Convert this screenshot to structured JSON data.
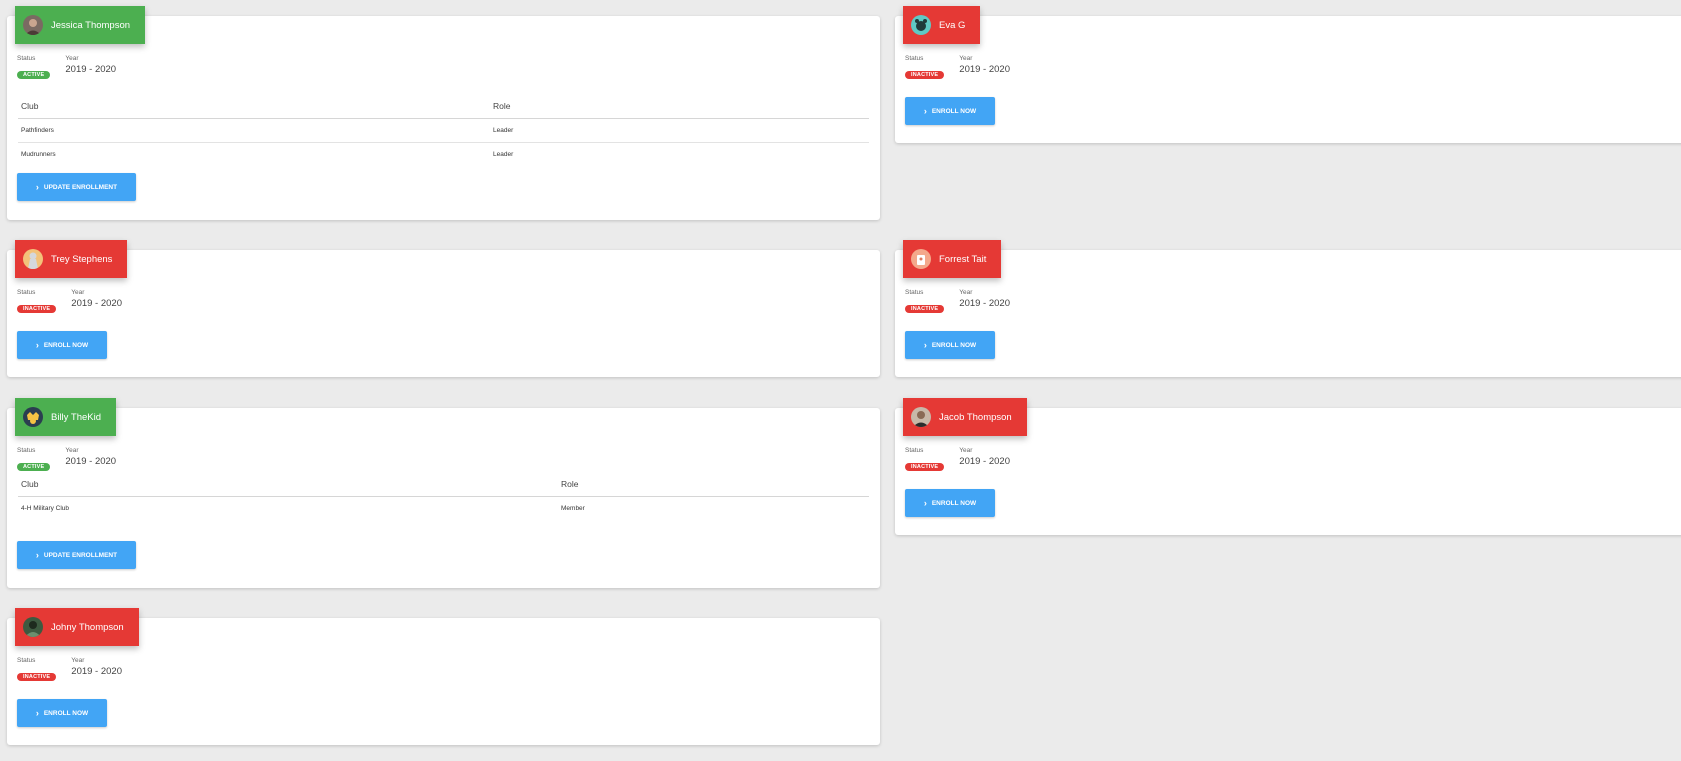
{
  "labels": {
    "status": "Status",
    "year": "Year",
    "club": "Club",
    "role": "Role",
    "update_enrollment": "UPDATE ENROLLMENT",
    "enroll_now": "ENROLL NOW"
  },
  "colors": {
    "active": "#4caf50",
    "inactive": "#e53935",
    "button": "#42a5f5"
  },
  "members": [
    {
      "name": "Jessica Thompson",
      "status": "ACTIVE",
      "year": "2019 - 2020",
      "clubs": [
        {
          "club": "Pathfinders",
          "role": "Leader"
        },
        {
          "club": "Mudrunners",
          "role": "Leader"
        }
      ]
    },
    {
      "name": "Eva G",
      "status": "INACTIVE",
      "year": "2019 - 2020"
    },
    {
      "name": "Trey Stephens",
      "status": "INACTIVE",
      "year": "2019 - 2020"
    },
    {
      "name": "Forrest Tait",
      "status": "INACTIVE",
      "year": "2019 - 2020"
    },
    {
      "name": "Billy TheKid",
      "status": "ACTIVE",
      "year": "2019 - 2020",
      "clubs": [
        {
          "club": "4-H Military Club",
          "role": "Member"
        }
      ]
    },
    {
      "name": "Jacob Thompson",
      "status": "INACTIVE",
      "year": "2019 - 2020"
    },
    {
      "name": "Johny Thompson",
      "status": "INACTIVE",
      "year": "2019 - 2020"
    }
  ]
}
